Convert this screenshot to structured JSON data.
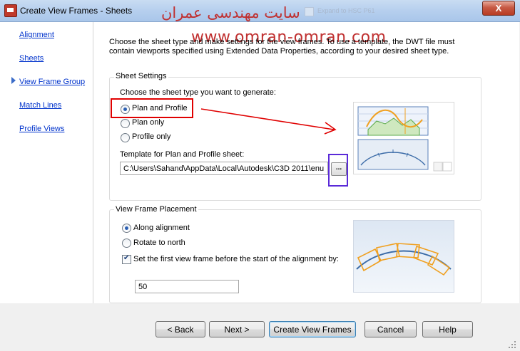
{
  "window": {
    "title": "Create View Frames - Sheets",
    "close_label": "X",
    "watermark_persian": "سایت مهندسی عمران",
    "watermark_url": "www.omran-omran.com",
    "ghost_text": "Expand to HSC P61"
  },
  "sidebar": {
    "items": [
      {
        "label": "Alignment"
      },
      {
        "label": "Sheets"
      },
      {
        "label": "View Frame Group"
      },
      {
        "label": "Match Lines"
      },
      {
        "label": "Profile Views"
      }
    ],
    "active_index": 1
  },
  "intro_text": "Choose the sheet type and make settings for the view frames. To use a template, the DWT file must contain viewports specified using Extended Data Properties, according to your desired sheet type.",
  "sheet_settings": {
    "title": "Sheet Settings",
    "prompt": "Choose the sheet type you want to generate:",
    "options": [
      {
        "label": "Plan and Profile",
        "selected": true
      },
      {
        "label": "Plan only",
        "selected": false
      },
      {
        "label": "Profile only",
        "selected": false
      }
    ],
    "template_label": "Template for Plan and Profile sheet:",
    "template_value": "C:\\Users\\Sahand\\AppData\\Local\\Autodesk\\C3D 2011\\enu",
    "browse_label": "..."
  },
  "placement": {
    "title": "View Frame Placement",
    "options": [
      {
        "label": "Along alignment",
        "selected": true
      },
      {
        "label": "Rotate to north",
        "selected": false
      }
    ],
    "checkbox_label": "Set the first view frame before the start of the alignment by:",
    "checkbox_checked": true,
    "offset_value": "50"
  },
  "buttons": {
    "back": "< Back",
    "next": "Next >",
    "create": "Create View Frames",
    "cancel": "Cancel",
    "help": "Help"
  },
  "colors": {
    "link": "#0033cc",
    "annotation_red": "#e00000",
    "annotation_blue": "#5a2ad8",
    "preview_orange": "#f0a020",
    "preview_green": "#58a848",
    "preview_blue": "#3c6ca8"
  }
}
